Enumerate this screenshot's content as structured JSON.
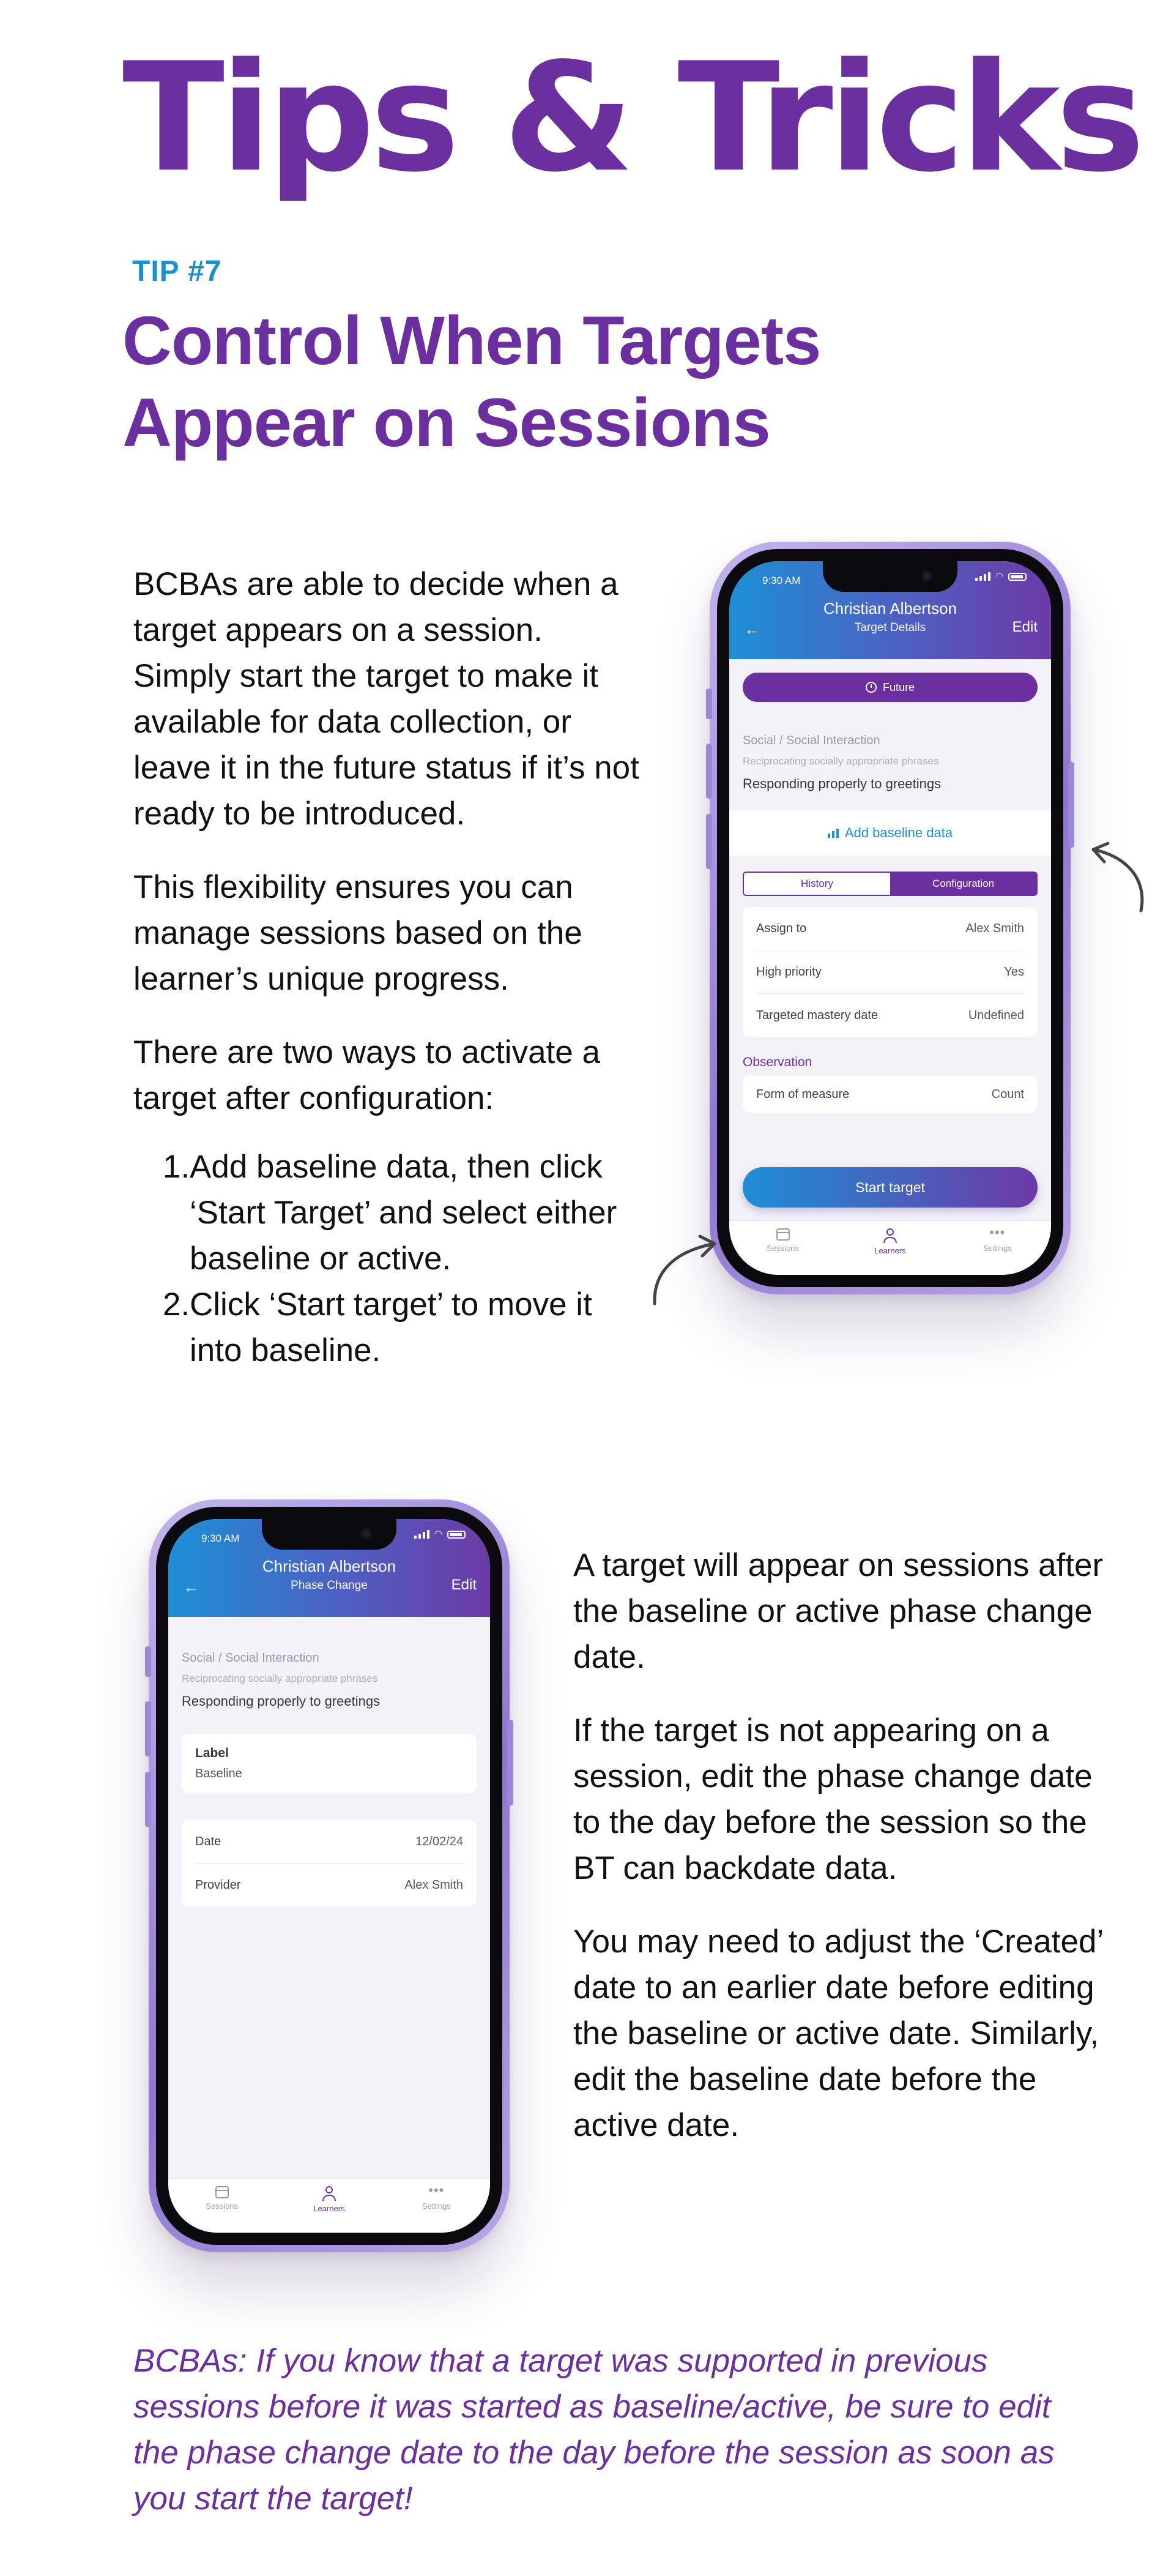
{
  "header": {
    "title": "Tips & Tricks",
    "tip_label": "TIP #7",
    "tip_title": "Control When Targets Appear on Sessions"
  },
  "intro": {
    "paragraph1": "BCBAs are able to decide when a target appears on a session. Simply start the target to make it available for data collection, or leave it in the future status if it’s not ready to be introduced.",
    "paragraph2": "This flexibility ensures you can manage sessions based on the learner’s unique progress.",
    "paragraph3": "There are two ways to activate a target after configuration:",
    "steps": [
      {
        "num": "1.",
        "text": "Add baseline data, then click ‘Start Target’ and select either baseline or active."
      },
      {
        "num": "2.",
        "text": "Click ‘Start target’ to move it into baseline."
      }
    ]
  },
  "right_text": {
    "paragraph1": "A target will appear on sessions after the baseline or active phase change date.",
    "paragraph2": "If the target is not appearing on a session, edit the phase change date to the day before the session so the BT can backdate data.",
    "paragraph3": "You may need to adjust the ‘Created’ date to an earlier date before editing the baseline or active date. Similarly, edit the baseline date before the active date."
  },
  "note": "BCBAs: If you know that a target was supported in previous sessions before it was started as baseline/active, be sure to edit the phase change date to the day before the session as soon as you start the target!",
  "phone1": {
    "time": "9:30 AM",
    "learner_name": "Christian Albertson",
    "screen_title": "Target Details",
    "edit_label": "Edit",
    "status_pill": "Future",
    "breadcrumb": "Social / Social Interaction",
    "breadcrumb_sub": "Reciprocating socially appropriate phrases",
    "target_name": "Responding properly to greetings",
    "baseline_link": "Add baseline data",
    "tab_history": "History",
    "tab_configuration": "Configuration",
    "details": [
      {
        "label": "Assign to",
        "value": "Alex Smith"
      },
      {
        "label": "High priority",
        "value": "Yes"
      },
      {
        "label": "Targeted mastery date",
        "value": "Undefined"
      }
    ],
    "observation_title": "Observation",
    "observation": {
      "label": "Form of measure",
      "value": "Count"
    },
    "start_button": "Start target",
    "tabbar": {
      "sessions": "Sessions",
      "learners": "Learners",
      "settings": "Settings"
    }
  },
  "phone2": {
    "time": "9:30 AM",
    "learner_name": "Christian Albertson",
    "screen_title": "Phase Change",
    "edit_label": "Edit",
    "breadcrumb": "Social / Social Interaction",
    "breadcrumb_sub": "Reciprocating socially appropriate phrases",
    "target_name": "Responding properly to greetings",
    "label_title": "Label",
    "label_value": "Baseline",
    "details": [
      {
        "label": "Date",
        "value": "12/02/24"
      },
      {
        "label": "Provider",
        "value": "Alex Smith"
      }
    ],
    "tabbar": {
      "sessions": "Sessions",
      "learners": "Learners",
      "settings": "Settings"
    }
  },
  "colors": {
    "brand_purple": "#6b2fa0",
    "tip_blue": "#1a8fd1",
    "gradient_start": "#1d8fd6",
    "gradient_end": "#6c3aa6"
  }
}
